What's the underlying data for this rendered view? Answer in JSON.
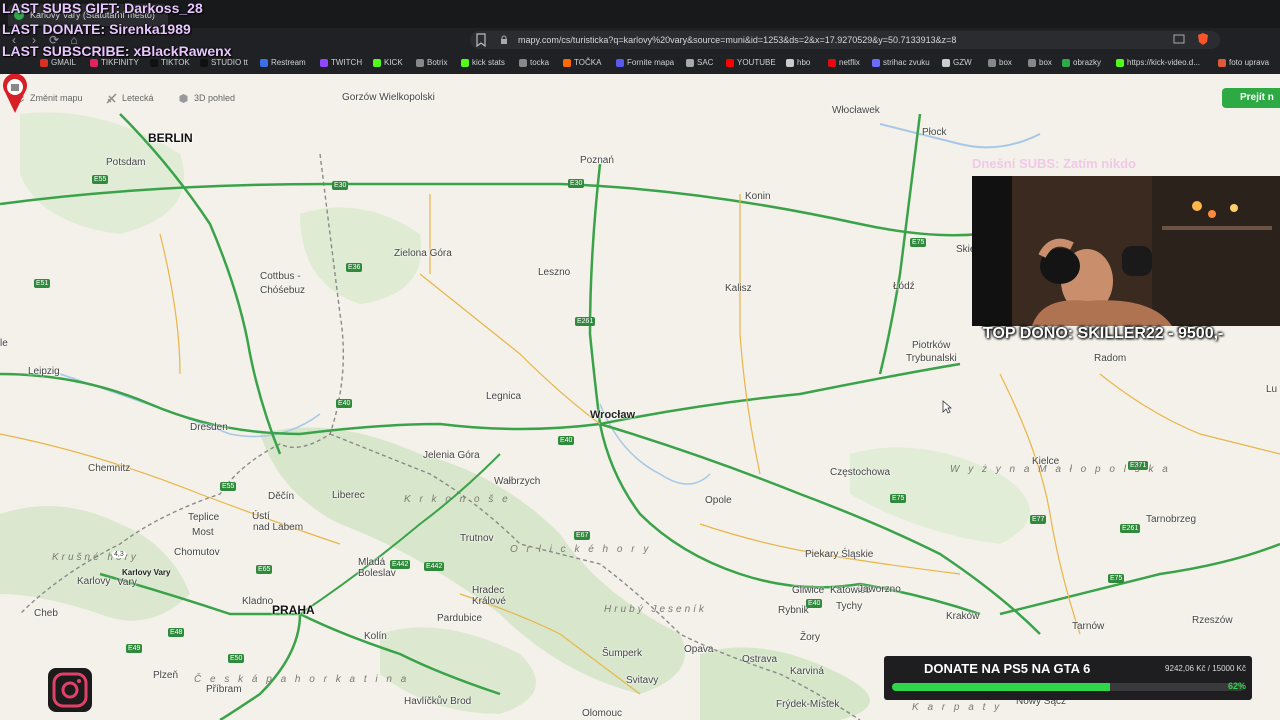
{
  "overlay": {
    "last_subs_gift": "LAST SUBS GIFT: Darkoss_28",
    "last_donate": "LAST DONATE: Sirenka1989",
    "last_subscribe": "LAST SUBSCRIBE: xBlackRawenx",
    "todays_subs": "Dnešní SUBS: Zatím nikdo",
    "top_dono": "TOP DONO: SKILLER22 - 9500,-"
  },
  "browser": {
    "tab_title": "Karlovy Vary (Statutární město)",
    "url": "mapy.com/cs/turisticka?q=karlovy%20vary&source=muni&id=1253&ds=2&x=17.9270529&y=50.7133913&z=8",
    "bookmarks": [
      {
        "label": "GMAIL",
        "color": "#d93025"
      },
      {
        "label": "TIKFINITY",
        "color": "#e0245e"
      },
      {
        "label": "TIKTOK",
        "color": "#111111"
      },
      {
        "label": "STUDIO tt",
        "color": "#111111"
      },
      {
        "label": "Restream",
        "color": "#3a6fe8"
      },
      {
        "label": "TWITCH",
        "color": "#9146ff"
      },
      {
        "label": "KICK",
        "color": "#53fc18"
      },
      {
        "label": "Botrix",
        "color": "#888888"
      },
      {
        "label": "kick stats",
        "color": "#53fc18"
      },
      {
        "label": "tocka",
        "color": "#888888"
      },
      {
        "label": "TOČKA",
        "color": "#ff6a00"
      },
      {
        "label": "Fornite mapa",
        "color": "#5a5af0"
      },
      {
        "label": "SAC",
        "color": "#aaaaaa"
      },
      {
        "label": "YOUTUBE",
        "color": "#ff0000"
      },
      {
        "label": "hbo",
        "color": "#cccccc"
      },
      {
        "label": "netflix",
        "color": "#e50914"
      },
      {
        "label": "strihac zvuku",
        "color": "#6b6bff"
      },
      {
        "label": "GZW",
        "color": "#cccccc"
      },
      {
        "label": "box",
        "color": "#888888"
      },
      {
        "label": "box",
        "color": "#888888"
      },
      {
        "label": "obrazky",
        "color": "#2ea84a"
      },
      {
        "label": "https://kick-video.d...",
        "color": "#53fc18"
      },
      {
        "label": "foto uprava",
        "color": "#e05a3a"
      }
    ]
  },
  "map": {
    "tools": {
      "change_map": "Změnit mapu",
      "aerial": "Letecká",
      "view_3d": "3D pohled"
    },
    "share_button": "Prejít n",
    "cities": [
      {
        "name": "Gorzów Wielkopolski",
        "cls": "city"
      },
      {
        "name": "BERLIN",
        "cls": "city cap"
      },
      {
        "name": "Potsdam",
        "cls": "city"
      },
      {
        "name": "Poznań",
        "cls": "city"
      },
      {
        "name": "Włocławek",
        "cls": "city"
      },
      {
        "name": "Płock",
        "cls": "city"
      },
      {
        "name": "Konin",
        "cls": "city"
      },
      {
        "name": "Zielona Góra",
        "cls": "city"
      },
      {
        "name": "Leszno",
        "cls": "city"
      },
      {
        "name": "Kalisz",
        "cls": "city"
      },
      {
        "name": "Łódź",
        "cls": "city"
      },
      {
        "name": "Cottbus -",
        "cls": "city"
      },
      {
        "name": "Chóśebuz",
        "cls": "city"
      },
      {
        "name": "Piotrków",
        "cls": "city"
      },
      {
        "name": "Trybunalski",
        "cls": "city"
      },
      {
        "name": "Radom",
        "cls": "city"
      },
      {
        "name": "Leipzig",
        "cls": "city"
      },
      {
        "name": "Legnica",
        "cls": "city"
      },
      {
        "name": "Wrocław",
        "cls": "city big"
      },
      {
        "name": "Dresden",
        "cls": "city"
      },
      {
        "name": "Jelenia Góra",
        "cls": "city"
      },
      {
        "name": "Chemnitz",
        "cls": "city"
      },
      {
        "name": "Wałbrzych",
        "cls": "city"
      },
      {
        "name": "Częstochowa",
        "cls": "city"
      },
      {
        "name": "Kielce",
        "cls": "city"
      },
      {
        "name": "Děčín",
        "cls": "city"
      },
      {
        "name": "Liberec",
        "cls": "city"
      },
      {
        "name": "Opole",
        "cls": "city"
      },
      {
        "name": "Tarnobrzeg",
        "cls": "city"
      },
      {
        "name": "Teplice",
        "cls": "city"
      },
      {
        "name": "Ústí",
        "cls": "city"
      },
      {
        "name": "nad Labem",
        "cls": "city"
      },
      {
        "name": "Most",
        "cls": "city"
      },
      {
        "name": "Trutnov",
        "cls": "city"
      },
      {
        "name": "Chomutov",
        "cls": "city"
      },
      {
        "name": "Piekary Śląskie",
        "cls": "city"
      },
      {
        "name": "Mladá",
        "cls": "city"
      },
      {
        "name": "Boleslav",
        "cls": "city"
      },
      {
        "name": "Gliwice",
        "cls": "city"
      },
      {
        "name": "Katowice",
        "cls": "city"
      },
      {
        "name": "Jaworzno",
        "cls": "city"
      },
      {
        "name": "Karlovy",
        "cls": "city"
      },
      {
        "name": "Vary",
        "cls": "city"
      },
      {
        "name": "Hradec",
        "cls": "city"
      },
      {
        "name": "Králové",
        "cls": "city"
      },
      {
        "name": "Rybnik",
        "cls": "city"
      },
      {
        "name": "Kladno",
        "cls": "city"
      },
      {
        "name": "PRAHA",
        "cls": "city cap"
      },
      {
        "name": "Pardubice",
        "cls": "city"
      },
      {
        "name": "Tychy",
        "cls": "city"
      },
      {
        "name": "Kraków",
        "cls": "city"
      },
      {
        "name": "Tarnów",
        "cls": "city"
      },
      {
        "name": "Rzeszów",
        "cls": "city"
      },
      {
        "name": "Cheb",
        "cls": "city"
      },
      {
        "name": "Kolín",
        "cls": "city"
      },
      {
        "name": "Žory",
        "cls": "city"
      },
      {
        "name": "Šumperk",
        "cls": "city"
      },
      {
        "name": "Opava",
        "cls": "city"
      },
      {
        "name": "Plzeň",
        "cls": "city"
      },
      {
        "name": "Ostrava",
        "cls": "city"
      },
      {
        "name": "Karviná",
        "cls": "city"
      },
      {
        "name": "Příbram",
        "cls": "city"
      },
      {
        "name": "Svitavy",
        "cls": "city"
      },
      {
        "name": "Havlíčkův Brod",
        "cls": "city"
      },
      {
        "name": "Frýdek-Místek",
        "cls": "city"
      },
      {
        "name": "Olomouc",
        "cls": "city"
      },
      {
        "name": "Nowy Sącz",
        "cls": "city"
      },
      {
        "name": "Skier",
        "cls": "city"
      },
      {
        "name": "Lu",
        "cls": "city"
      },
      {
        "name": "le",
        "cls": "city"
      }
    ],
    "regions": [
      "K r k o n o š e",
      "Hrubý Jeseník",
      "O r l i c k é h o r y",
      "W y ż y n a   M a ł o p o l s k a",
      "Č e s k á  p a h o r k a t i n a",
      "Krušné hory",
      "K a r p a t y"
    ],
    "roads": [
      "E55",
      "E30",
      "E30",
      "E261",
      "E75",
      "E75",
      "E36",
      "E40",
      "E40",
      "E65",
      "E67",
      "E442",
      "E442",
      "E48",
      "E49",
      "E50",
      "E55",
      "E371",
      "E77",
      "E261",
      "E40",
      "E75",
      "E30",
      "E51"
    ],
    "marker": {
      "label": "Karlovy Vary",
      "rating": "4,3"
    }
  },
  "donation": {
    "title": "DONATE NA PS5 NA GTA 6",
    "amount": "9242,06 Kč / 15000 Kč",
    "percent_label": "62%",
    "progress": 0.62
  },
  "colors": {
    "accent_green": "#2fd64a",
    "overlay_text": "#e8c6ff",
    "map_bg": "#f3f1e9"
  }
}
